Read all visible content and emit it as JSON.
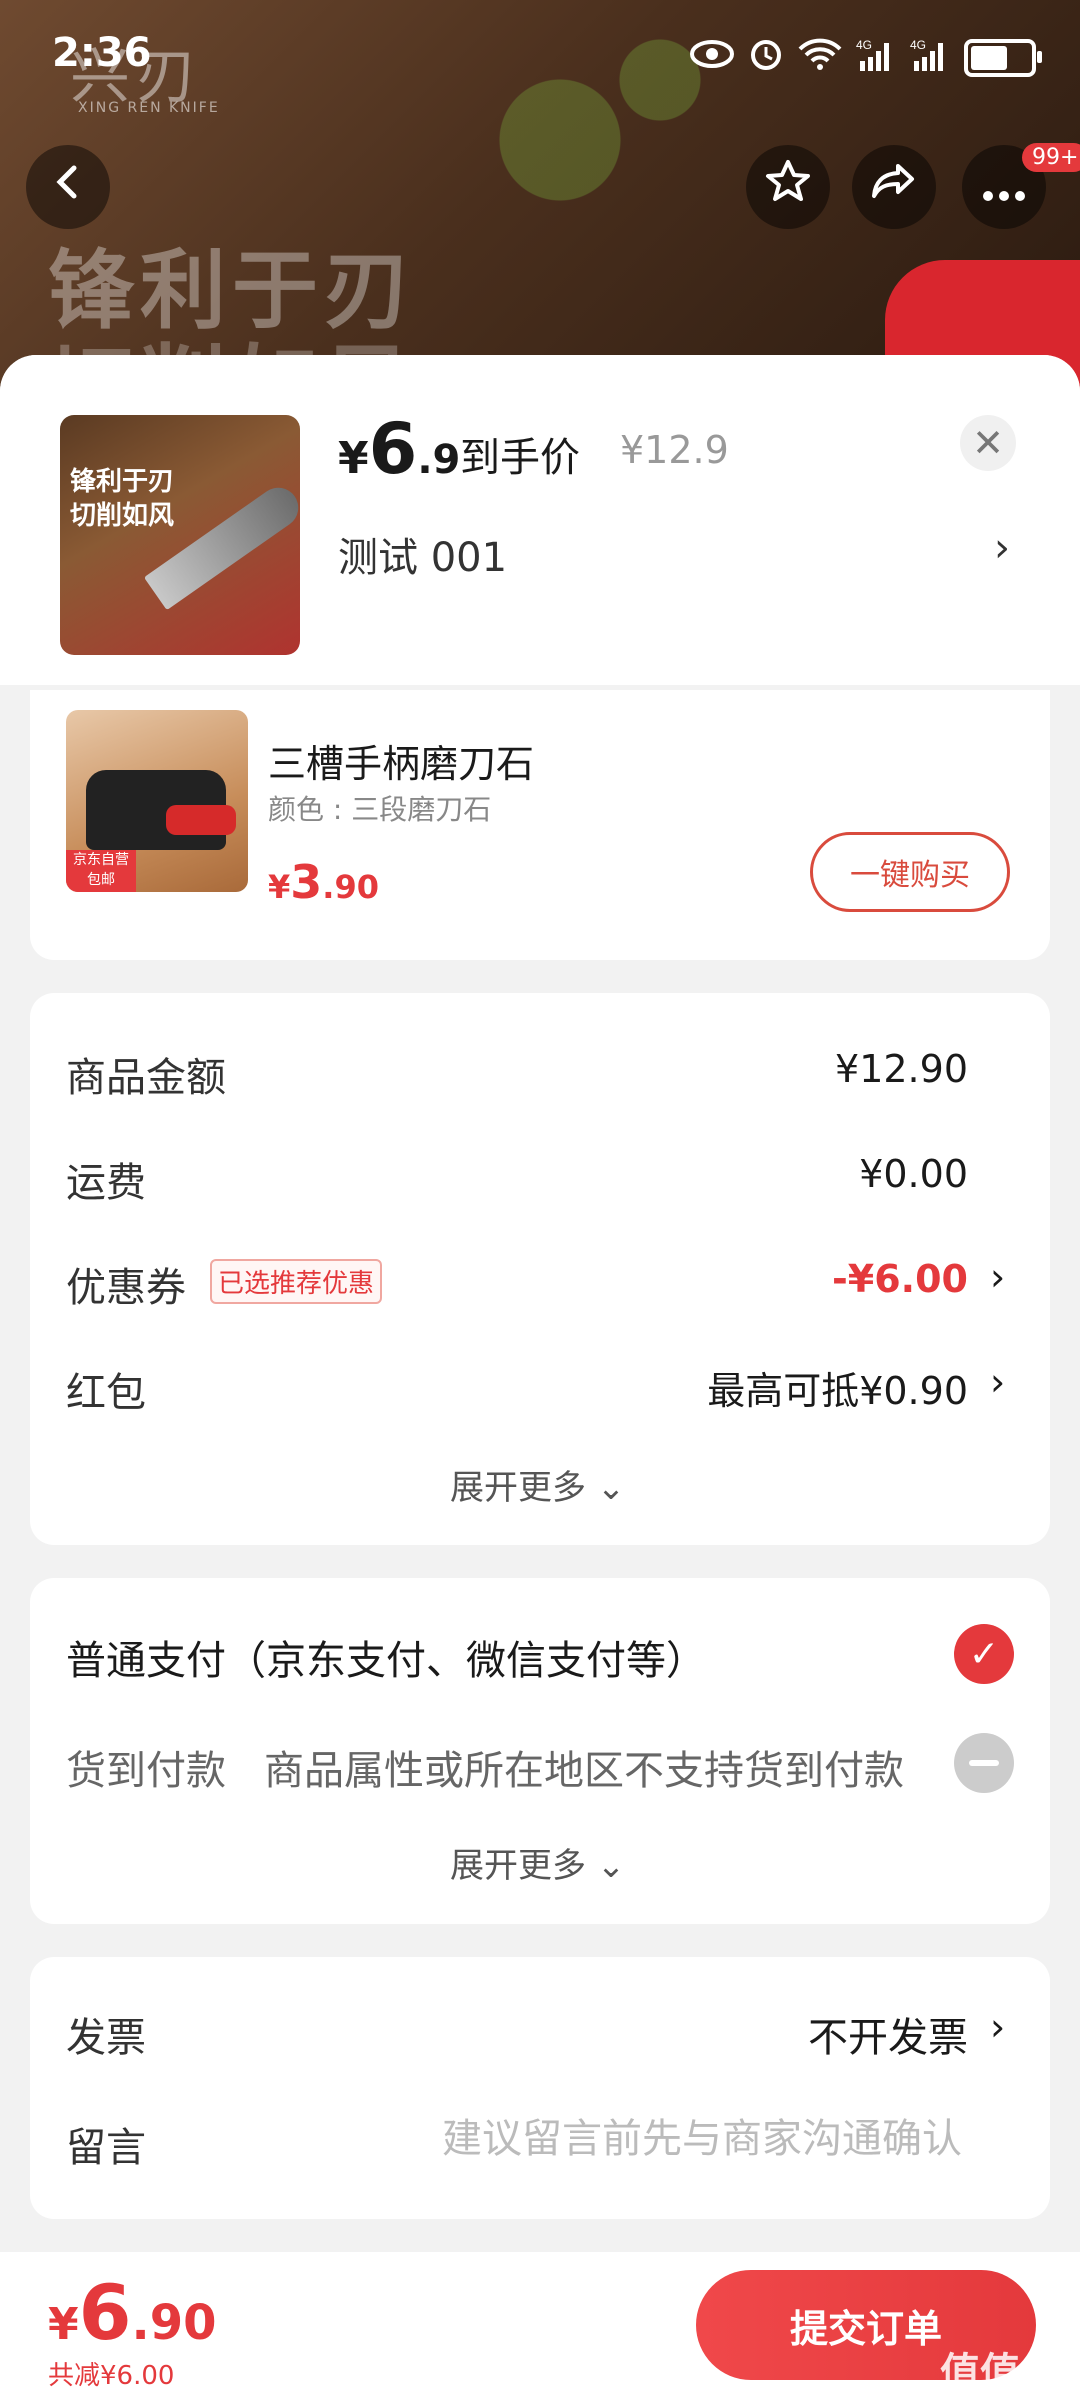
{
  "status_bar": {
    "time": "2:36",
    "icons": [
      "eye-icon",
      "alarm-icon",
      "wifi-icon",
      "4g-signal-icon",
      "4g-signal-icon",
      "battery-icon"
    ],
    "battery_level": 0.7
  },
  "hero": {
    "brand": "兴刃",
    "brand_sub": "XING REN KNIFE",
    "slogan": "锋利于刃",
    "slogan2": "切削如风",
    "more_badge": "99+"
  },
  "product": {
    "thumb_text": "锋利于刃\n切削如风",
    "price_currency": "¥",
    "price_int": "6",
    "price_dec": ".9",
    "price_label": "到手价",
    "original_price": "¥12.9",
    "spec": "测试  001",
    "spec_arrow": "›",
    "close": "✕"
  },
  "addon": {
    "image_tag": "京东自营 包邮",
    "name": "三槽手柄磨刀石",
    "color": "颜色 : 三段磨刀石",
    "price_currency": "¥",
    "price_int": "3",
    "price_dec": ".90",
    "buy_label": "一键购买"
  },
  "summary": {
    "goods_label": "商品金额",
    "goods_val": "¥12.90",
    "shipping_label": "运费",
    "shipping_val": "¥0.00",
    "coupon_label": "优惠券",
    "coupon_tag": "已选推荐优惠",
    "coupon_val": "-¥6.00",
    "redpacket_label": "红包",
    "redpacket_val": "最高可抵¥0.90",
    "arrow": "›",
    "expand": "展开更多 ⌄"
  },
  "payment": {
    "normal": "普通支付（京东支付、微信支付等）",
    "cod_label": "货到付款",
    "cod_note": "商品属性或所在地区不支持货到付款",
    "check": "✓",
    "expand": "展开更多 ⌄"
  },
  "extra": {
    "invoice_label": "发票",
    "invoice_val": "不开发票",
    "arrow": "›",
    "note_label": "留言",
    "note_placeholder": "建议留言前先与商家沟通确认"
  },
  "footer": {
    "currency": "¥",
    "total_int": "6",
    "total_dec": ".90",
    "saved": "共减¥6.00",
    "submit": "提交订单",
    "watermark": "值值值"
  }
}
